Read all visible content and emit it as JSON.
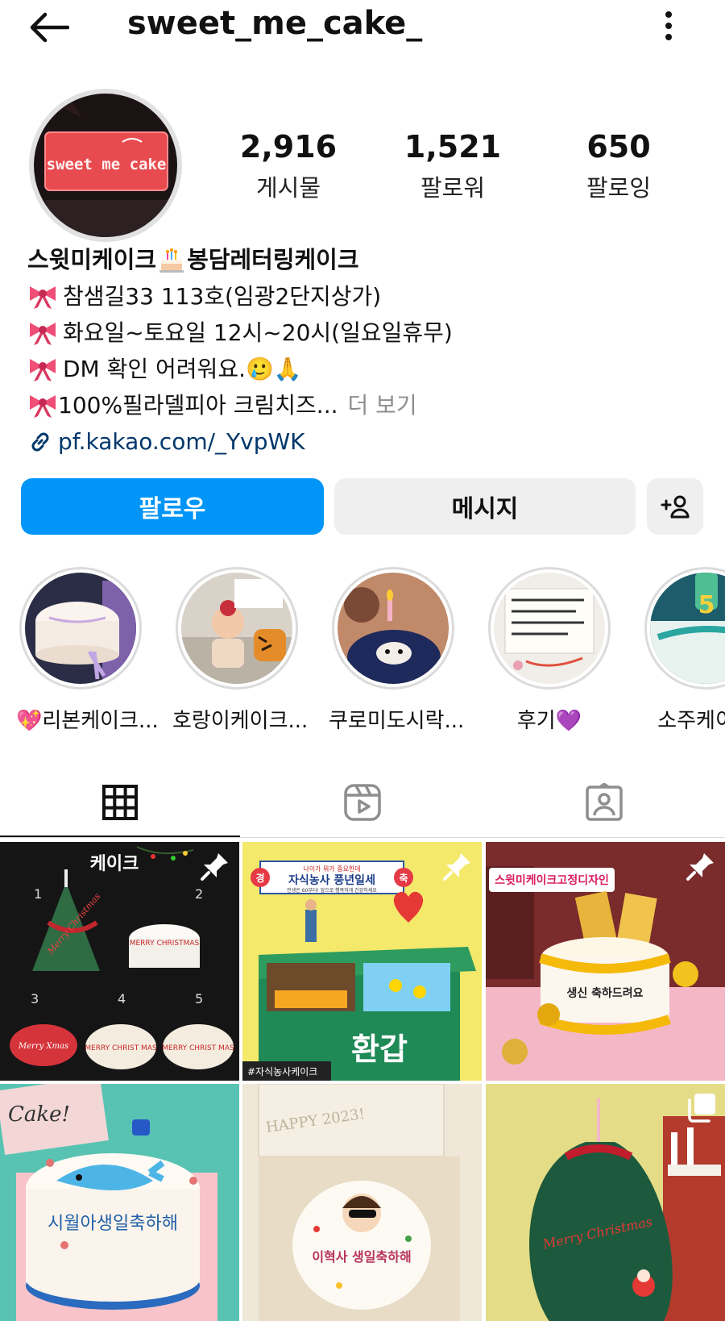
{
  "header": {
    "username": "sweet_me_cake_"
  },
  "profile": {
    "avatar_sign_text": "sweet me cake",
    "stats": [
      {
        "value": "2,916",
        "label": "게시물"
      },
      {
        "value": "1,521",
        "label": "팔로워"
      },
      {
        "value": "650",
        "label": "팔로잉"
      }
    ],
    "bio": {
      "name_part1": "스윗미케이크",
      "name_emoji": "🎂",
      "name_part2": "봉담레터링케이크",
      "lines": [
        "참샘길33 113호(임광2단지상가)",
        "화요일~토요일 12시~20시(일요일휴무)",
        "DM 확인 어려워요.🥲🙏"
      ],
      "last_line": "100%필라델피아 크림치즈...",
      "more_label": "더 보기",
      "link": "pf.kakao.com/_YvpWK"
    }
  },
  "buttons": {
    "follow": "팔로우",
    "message": "메시지"
  },
  "highlights": [
    {
      "label": "💖리본케이크..."
    },
    {
      "label": "호랑이케이크..."
    },
    {
      "label": "쿠로미도시락..."
    },
    {
      "label": "후기💜"
    },
    {
      "label": "소주케이크"
    }
  ],
  "posts": [
    {
      "overlay_text": "케이크",
      "numbers": [
        "1",
        "2",
        "3",
        "4",
        "5"
      ],
      "cake_texts": [
        "Merry Christmas",
        "MERRY CHRISTMAS",
        "Merry Xmas",
        "MERRY CHRIST MAS"
      ],
      "pinned": true
    },
    {
      "banner_top": "나이가 뭐가 중요한데",
      "banner_main": "자식농사 풍년일세",
      "banner_sub": "인생은 60부터! 앞으로 행복하게 건강하세요",
      "left_badge": "경",
      "right_badge": "축",
      "cake_text": "환갑",
      "tag": "#자식농사케이크",
      "pinned": true
    },
    {
      "banner": "스윗미케이크고정디자인",
      "cake_text": "생신 축하드려요",
      "pinned": true
    },
    {
      "corner_text": "Cake!",
      "cake_text": "시월아생일축하해"
    },
    {
      "lid_text": "HAPPY 2023!",
      "cake_text": "이혁사 생일축하해"
    },
    {
      "cake_text": "Merry Christmas",
      "multi": true
    }
  ],
  "colors": {
    "accent_blue": "#0095f6",
    "link_blue": "#00376b",
    "button_gray": "#efefef",
    "muted_text": "#8e8e8e"
  }
}
